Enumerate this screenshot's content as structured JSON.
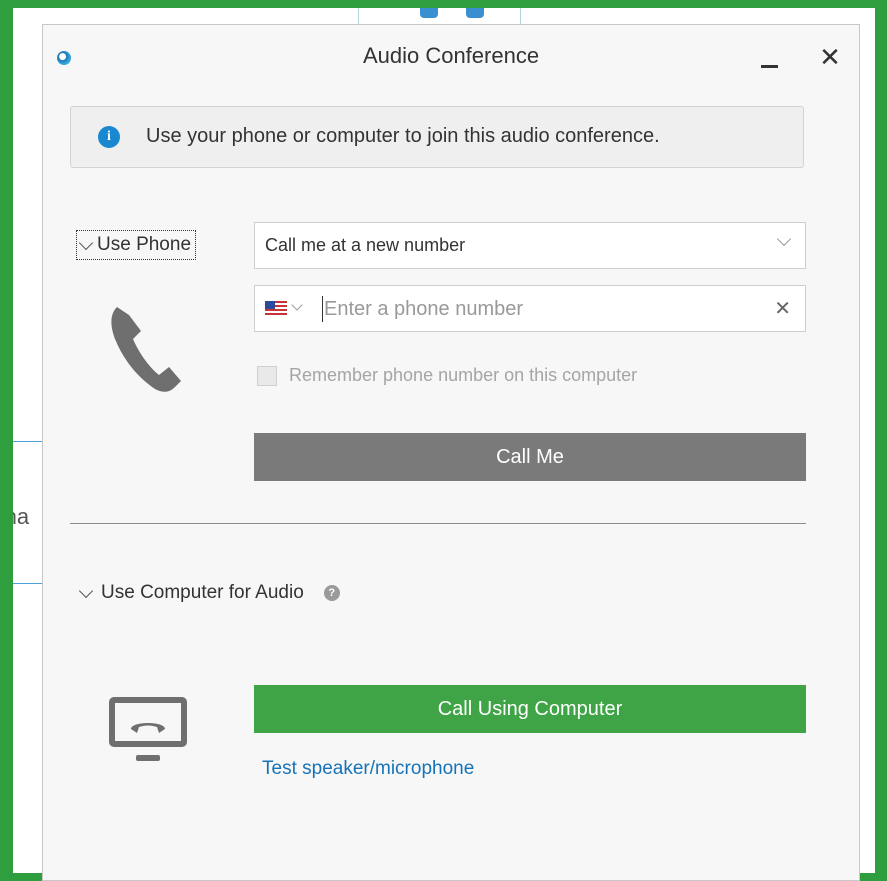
{
  "background": {
    "partial_text": "Sha"
  },
  "dialog": {
    "title": "Audio Conference",
    "minimize_glyph": "_",
    "close_glyph": "✕"
  },
  "info_banner": {
    "icon": "info-icon",
    "icon_glyph": "i",
    "text": "Use your phone or computer to join this audio conference."
  },
  "phone_section": {
    "toggle_label": "Use Phone",
    "call_option": "Call me at a new number",
    "country_flag": "us-flag-icon",
    "phone_placeholder": "Enter a phone number",
    "phone_value": "",
    "clear_glyph": "✕",
    "remember_label": "Remember phone number on this computer",
    "remember_checked": false,
    "call_me_label": "Call Me"
  },
  "computer_section": {
    "toggle_label": "Use Computer for Audio",
    "help_glyph": "?",
    "call_button_label": "Call Using Computer",
    "test_link_label": "Test speaker/microphone"
  },
  "colors": {
    "frame_green": "#2e9e3e",
    "call_me_gray": "#7a7a7a",
    "call_computer_green": "#3ea446",
    "link_blue": "#1673b8",
    "info_blue": "#1a88d1"
  }
}
